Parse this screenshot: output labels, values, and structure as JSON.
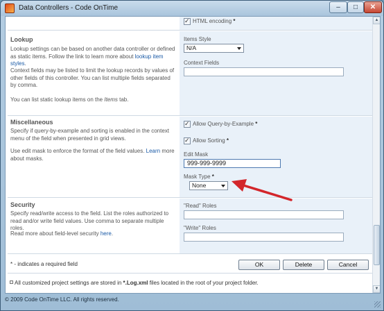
{
  "window": {
    "title": "Data Controllers - Code OnTime",
    "minimize": "–",
    "maximize": "□",
    "close": "✕"
  },
  "top": {
    "html_encoding": "HTML encoding",
    "req": "*"
  },
  "lookup": {
    "title": "Lookup",
    "p1_a": "Lookup settings can be based on another data controller or defined as static items. Follow the link to learn more about ",
    "p1_link": "lookup item styles",
    "p1_b": ".",
    "p2": "Context fields may be listed to limit the lookup records by values of other fields of this controller. You can list multiple fields separated by comma.",
    "p3_a": "You can list static lookup items on the ",
    "p3_em": "Items",
    "p3_b": " tab.",
    "items_style_label": "Items Style",
    "items_style_value": "N/A",
    "context_fields_label": "Context Fields",
    "context_fields_value": ""
  },
  "misc": {
    "title": "Miscellaneous",
    "p1": "Specify if query-by-example and sorting is enabled in the context menu of the field when presented in grid views.",
    "p2_a": "Use edit mask to enforce the format of the field values. ",
    "p2_link": "Learn",
    "p2_b": " more about masks.",
    "allow_qbe": "Allow Query-by-Example",
    "allow_sorting": "Allow Sorting",
    "edit_mask_label": "Edit Mask",
    "edit_mask_value": "999-999-9999",
    "mask_type_label": "Mask Type",
    "mask_type_value": "None",
    "req": "*"
  },
  "security": {
    "title": "Security",
    "p1": "Specify read/write access to the field. List the roles authorized to read and/or write field values. Use comma to separate multiple roles.",
    "p2_a": "Read more about field-level security ",
    "p2_link": "here",
    "p2_b": ".",
    "read_roles_label": "\"Read\" Roles",
    "write_roles_label": "\"Write\" Roles",
    "read_roles_value": "",
    "write_roles_value": ""
  },
  "footer": {
    "required_note": "* - indicates a required field",
    "ok": "OK",
    "delete": "Delete",
    "cancel": "Cancel"
  },
  "note": {
    "a": "All customized project settings are stored in ",
    "b": "*.Log.xml",
    "c": " files located in the root of your project folder."
  },
  "status": "© 2009 Code OnTime LLC. All rights reserved.",
  "colors": {
    "arrow": "#d3262b",
    "accent": "#e9f1f9"
  }
}
